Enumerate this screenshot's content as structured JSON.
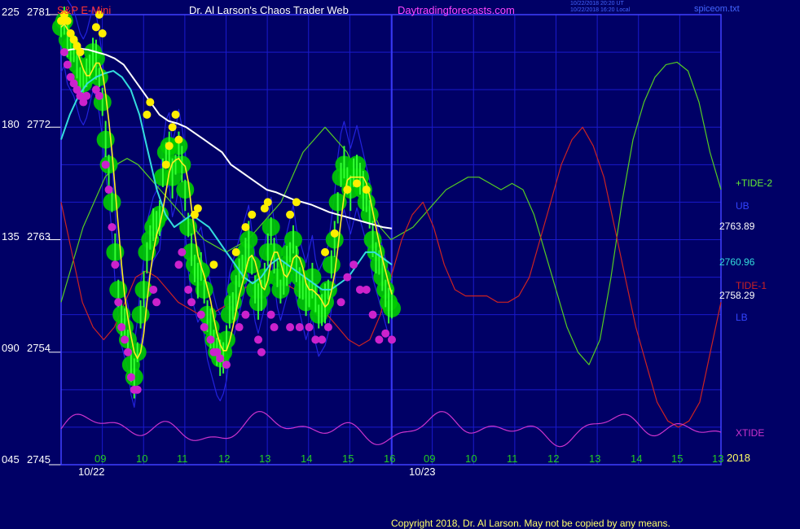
{
  "header": {
    "symbol": "S&P E-Mini",
    "title": "Dr. Al Larson's Chaos Trader Web",
    "site": "Daytradingforecasts.com",
    "timestamp_1": "10/22/2018 20:20 UT",
    "timestamp_2": "10/22/2018 16:20 Local",
    "file": "spiceom.txt"
  },
  "footer": {
    "copyright": "Copyright 2018, Dr. Al Larson. May not be copied by any means."
  },
  "colors": {
    "background": "#000066",
    "grid": "#1a1acc",
    "frame": "#4040ff",
    "price_green": "#00cc00",
    "price_bright": "#33ff33",
    "high_dot": "#ffee00",
    "low_dot": "#cc22cc",
    "ma_white": "#ffffff",
    "ma_cyan": "#33dddd",
    "ma_yellow": "#ffee22",
    "tide2": "#55cc22",
    "tide1": "#cc2222",
    "band": "#2222dd",
    "xtide": "#cc33cc"
  },
  "chart_data": {
    "type": "line",
    "title": "S&P E-Mini",
    "ylim": [
      2745,
      2781
    ],
    "y_ticks": [
      {
        "osc": "225",
        "price": "2781"
      },
      {
        "osc": "180",
        "price": "2772"
      },
      {
        "osc": "135",
        "price": "2763"
      },
      {
        "osc": "090",
        "price": "2754"
      },
      {
        "osc": "045",
        "price": "2745"
      }
    ],
    "x_hour_labels": [
      "09",
      "10",
      "11",
      "12",
      "13",
      "14",
      "15",
      "16",
      "09",
      "10",
      "11",
      "12",
      "13",
      "14",
      "15",
      "13"
    ],
    "x_date_labels": [
      "10/22",
      "10/23"
    ],
    "series_labels": {
      "tide2": "+TIDE-2",
      "ub": "UB",
      "tide1": "TIDE-1",
      "lb": "LB",
      "xtide": "XTIDE",
      "year": "2018"
    },
    "value_labels": {
      "white_ma": "2763.89",
      "cyan_ma": "2760.96",
      "yellow_ma": "2758.29"
    },
    "price_close": [
      2780,
      2780.5,
      2779,
      2778.5,
      2778,
      2777,
      2776,
      2775.5,
      2776,
      2777,
      2778,
      2777.5,
      2776,
      2774,
      2771,
      2769,
      2766,
      2762,
      2759,
      2757,
      2756,
      2755,
      2753,
      2752,
      2754,
      2757,
      2759,
      2762,
      2763,
      2764,
      2764.5,
      2765,
      2768,
      2770,
      2770.5,
      2768,
      2769,
      2770.5,
      2769,
      2767,
      2764,
      2762,
      2761,
      2760,
      2760.5,
      2759,
      2757,
      2756,
      2755,
      2754,
      2753.5,
      2754,
      2755,
      2757,
      2758,
      2759,
      2760,
      2761,
      2762,
      2763,
      2761,
      2759,
      2758,
      2759,
      2760,
      2762,
      2764,
      2762,
      2760,
      2759,
      2760,
      2761,
      2762,
      2763,
      2761,
      2760,
      2759,
      2758,
      2759,
      2760,
      2758,
      2757,
      2757.5,
      2758,
      2759,
      2761,
      2763,
      2766,
      2768,
      2769,
      2768,
      2767,
      2768,
      2769,
      2768,
      2767,
      2766,
      2765,
      2763,
      2762,
      2761,
      2760,
      2759,
      2758,
      2757.5
    ],
    "high_dots": [
      [
        0,
        2780.5
      ],
      [
        1,
        2781
      ],
      [
        2,
        2780.5
      ],
      [
        3,
        2779.5
      ],
      [
        4,
        2779
      ],
      [
        5,
        2778.5
      ],
      [
        6,
        2778
      ],
      [
        11,
        2780
      ],
      [
        12,
        2781
      ],
      [
        13,
        2779.5
      ],
      [
        27,
        2773
      ],
      [
        28,
        2774
      ],
      [
        33,
        2769
      ],
      [
        34,
        2770.5
      ],
      [
        35,
        2772
      ],
      [
        36,
        2773
      ],
      [
        37,
        2771
      ],
      [
        42,
        2765
      ],
      [
        43,
        2765.5
      ],
      [
        48,
        2761
      ],
      [
        55,
        2762
      ],
      [
        58,
        2764
      ],
      [
        60,
        2765
      ],
      [
        64,
        2765.5
      ],
      [
        65,
        2766
      ],
      [
        72,
        2765
      ],
      [
        74,
        2766
      ],
      [
        83,
        2762
      ],
      [
        86,
        2763.5
      ],
      [
        90,
        2767
      ],
      [
        93,
        2767.5
      ],
      [
        96,
        2767
      ]
    ],
    "low_dots": [
      [
        1,
        2778
      ],
      [
        2,
        2777
      ],
      [
        3,
        2776
      ],
      [
        4,
        2775.5
      ],
      [
        5,
        2775
      ],
      [
        6,
        2774.5
      ],
      [
        7,
        2774
      ],
      [
        8,
        2774.5
      ],
      [
        11,
        2775
      ],
      [
        12,
        2774.5
      ],
      [
        14,
        2769
      ],
      [
        15,
        2767
      ],
      [
        16,
        2764
      ],
      [
        17,
        2761
      ],
      [
        18,
        2758
      ],
      [
        19,
        2756
      ],
      [
        20,
        2755
      ],
      [
        21,
        2754
      ],
      [
        22,
        2752
      ],
      [
        23,
        2751
      ],
      [
        24,
        2751
      ],
      [
        29,
        2759
      ],
      [
        30,
        2758
      ],
      [
        37,
        2761
      ],
      [
        38,
        2762
      ],
      [
        40,
        2759
      ],
      [
        41,
        2758
      ],
      [
        44,
        2757
      ],
      [
        45,
        2756
      ],
      [
        47,
        2755
      ],
      [
        48,
        2754
      ],
      [
        49,
        2754
      ],
      [
        50,
        2753.5
      ],
      [
        52,
        2753
      ],
      [
        56,
        2756
      ],
      [
        58,
        2757
      ],
      [
        62,
        2755
      ],
      [
        63,
        2754
      ],
      [
        66,
        2757
      ],
      [
        67,
        2756
      ],
      [
        72,
        2756
      ],
      [
        75,
        2756
      ],
      [
        78,
        2756
      ],
      [
        80,
        2755
      ],
      [
        82,
        2755
      ],
      [
        84,
        2756
      ],
      [
        88,
        2758
      ],
      [
        90,
        2760
      ],
      [
        92,
        2761
      ],
      [
        94,
        2759
      ],
      [
        96,
        2759
      ],
      [
        98,
        2757
      ],
      [
        100,
        2755
      ],
      [
        102,
        2755.5
      ],
      [
        104,
        2755
      ]
    ],
    "white_ma": [
      2778,
      2778.2,
      2778.3,
      2778.2,
      2778,
      2777.8,
      2777.5,
      2777,
      2776,
      2775,
      2774,
      2773,
      2772.5,
      2772.3,
      2772,
      2771.5,
      2771,
      2770.5,
      2770,
      2769,
      2768.5,
      2768,
      2767.5,
      2767,
      2766.8,
      2766.5,
      2766.2,
      2766,
      2765.8,
      2765.5,
      2765.2,
      2765,
      2764.8,
      2764.6,
      2764.4,
      2764.2,
      2764,
      2763.9
    ],
    "cyan_ma": [
      2771,
      2773,
      2774.5,
      2775.5,
      2776,
      2776.3,
      2776.5,
      2776,
      2775,
      2773,
      2770,
      2767,
      2765,
      2764,
      2764.5,
      2765,
      2764.5,
      2764,
      2763,
      2762,
      2761,
      2760,
      2759.5,
      2760,
      2761,
      2761.5,
      2761,
      2760.5,
      2760,
      2759.5,
      2759,
      2759,
      2759.5,
      2760,
      2761,
      2762,
      2762,
      2761.5,
      2761
    ],
    "tide2": [
      2758,
      2761,
      2764,
      2766,
      2768,
      2769,
      2769.5,
      2769,
      2768,
      2767,
      2766,
      2765,
      2764,
      2763,
      2762.5,
      2762,
      2762.5,
      2763,
      2764,
      2765,
      2766,
      2768,
      2770,
      2771,
      2772,
      2771,
      2770,
      2768,
      2766,
      2764,
      2763,
      2763.5,
      2764,
      2765,
      2766,
      2767,
      2767.5,
      2768,
      2768,
      2767.5,
      2767,
      2767.5,
      2767,
      2765,
      2762,
      2759,
      2756,
      2754,
      2753,
      2755,
      2760,
      2766,
      2771,
      2774,
      2776,
      2777,
      2777.2,
      2776.5,
      2774,
      2770,
      2767
    ],
    "tide1": [
      2766,
      2762,
      2758,
      2756,
      2755,
      2756,
      2758,
      2760,
      2760.5,
      2760,
      2759,
      2758,
      2757.5,
      2757,
      2757,
      2757.5,
      2758,
      2759,
      2759.5,
      2760,
      2760,
      2759.5,
      2759,
      2758.5,
      2758,
      2757,
      2756,
      2755,
      2754.5,
      2755,
      2757,
      2760,
      2763,
      2765,
      2766,
      2764,
      2761,
      2759,
      2758.5,
      2758.5,
      2758.5,
      2758,
      2758,
      2758.5,
      2760,
      2763,
      2766,
      2769,
      2771,
      2772,
      2770.5,
      2768,
      2764,
      2760,
      2756,
      2753,
      2750,
      2748.5,
      2748,
      2748.5,
      2750,
      2754,
      2758
    ]
  }
}
